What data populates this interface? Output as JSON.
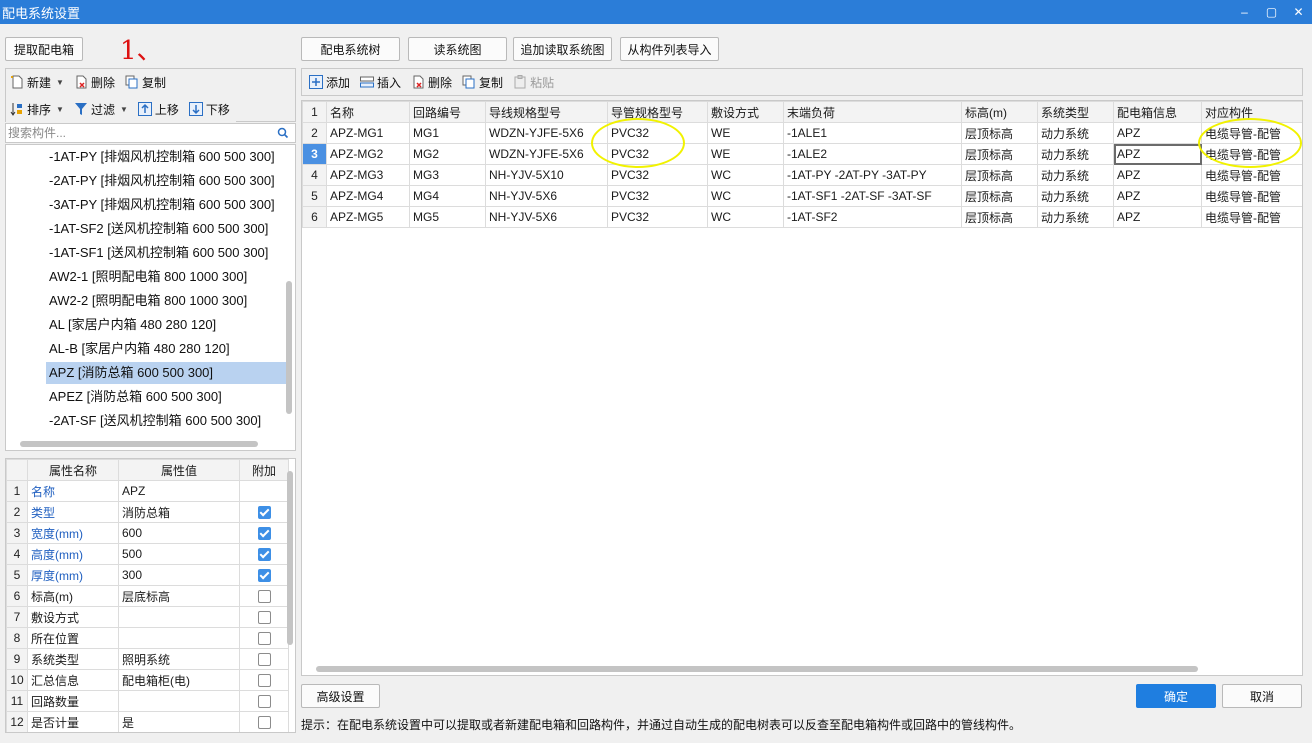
{
  "window": {
    "title": "配电系统设置",
    "minimize": "–",
    "maximize": "▢",
    "close": "✕"
  },
  "annotation": "1、",
  "left": {
    "extract_button": "提取配电箱",
    "toolbar1": {
      "new": "新建",
      "delete": "删除",
      "copy": "复制"
    },
    "toolbar2": {
      "sort": "排序",
      "filter": "过滤",
      "up": "上移",
      "down": "下移"
    },
    "search_placeholder": "搜索构件...",
    "tree_items": [
      "-1AT-PY [排烟风机控制箱 600 500 300]",
      "-2AT-PY [排烟风机控制箱 600 500 300]",
      "-3AT-PY [排烟风机控制箱 600 500 300]",
      "-1AT-SF2 [送风机控制箱 600 500 300]",
      "-1AT-SF1 [送风机控制箱 600 500 300]",
      "AW2-1 [照明配电箱 800 1000 300]",
      "AW2-2 [照明配电箱 800 1000 300]",
      "AL [家居户内箱 480 280 120]",
      "AL-B [家居户内箱 480 280 120]",
      "APZ [消防总箱 600 500 300]",
      "APEZ [消防总箱 600 500 300]",
      "-2AT-SF [送风机控制箱 600 500 300]"
    ],
    "properties": {
      "headers": [
        "属性名称",
        "属性值",
        "附加"
      ],
      "rows": [
        {
          "n": "1",
          "name": "名称",
          "value": "APZ",
          "blue": true,
          "check": null
        },
        {
          "n": "2",
          "name": "类型",
          "value": "消防总箱",
          "blue": true,
          "check": true
        },
        {
          "n": "3",
          "name": "宽度(mm)",
          "value": "600",
          "blue": true,
          "check": true
        },
        {
          "n": "4",
          "name": "高度(mm)",
          "value": "500",
          "blue": true,
          "check": true
        },
        {
          "n": "5",
          "name": "厚度(mm)",
          "value": "300",
          "blue": true,
          "check": true
        },
        {
          "n": "6",
          "name": "标高(m)",
          "value": "层底标高",
          "blue": false,
          "check": false
        },
        {
          "n": "7",
          "name": "敷设方式",
          "value": "",
          "blue": false,
          "check": false
        },
        {
          "n": "8",
          "name": "所在位置",
          "value": "",
          "blue": false,
          "check": false
        },
        {
          "n": "9",
          "name": "系统类型",
          "value": "照明系统",
          "blue": false,
          "check": false
        },
        {
          "n": "10",
          "name": "汇总信息",
          "value": "配电箱柜(电)",
          "blue": false,
          "check": false
        },
        {
          "n": "11",
          "name": "回路数量",
          "value": "",
          "blue": false,
          "check": false
        },
        {
          "n": "12",
          "name": "是否计量",
          "value": "是",
          "blue": false,
          "check": false
        }
      ]
    }
  },
  "top_buttons": {
    "tree": "配电系统树",
    "read": "读系统图",
    "append": "追加读取系统图",
    "import": "从构件列表导入"
  },
  "grid_toolbar": {
    "add": "添加",
    "insert": "插入",
    "delete": "删除",
    "copy": "复制",
    "paste": "粘贴"
  },
  "grid": {
    "headers": [
      "名称",
      "回路编号",
      "导线规格型号",
      "导管规格型号",
      "敷设方式",
      "末端负荷",
      "标高(m)",
      "系统类型",
      "配电箱信息",
      "对应构件"
    ],
    "rows": [
      {
        "n": "2",
        "cells": [
          "APZ-MG1",
          "MG1",
          "WDZN-YJFE-5X6",
          "PVC32",
          "WE",
          "-1ALE1",
          "层顶标高",
          "动力系统",
          "APZ",
          "电缆导管-配管"
        ]
      },
      {
        "n": "3",
        "cells": [
          "APZ-MG2",
          "MG2",
          "WDZN-YJFE-5X6",
          "PVC32",
          "WE",
          "-1ALE2",
          "层顶标高",
          "动力系统",
          "APZ",
          "电缆导管-配管"
        ]
      },
      {
        "n": "4",
        "cells": [
          "APZ-MG3",
          "MG3",
          "NH-YJV-5X10",
          "PVC32",
          "WC",
          "-1AT-PY -2AT-PY -3AT-PY",
          "层顶标高",
          "动力系统",
          "APZ",
          "电缆导管-配管"
        ]
      },
      {
        "n": "5",
        "cells": [
          "APZ-MG4",
          "MG4",
          "NH-YJV-5X6",
          "PVC32",
          "WC",
          "-1AT-SF1 -2AT-SF -3AT-SF",
          "层顶标高",
          "动力系统",
          "APZ",
          "电缆导管-配管"
        ]
      },
      {
        "n": "6",
        "cells": [
          "APZ-MG5",
          "MG5",
          "NH-YJV-5X6",
          "PVC32",
          "WC",
          "-1AT-SF2",
          "层顶标高",
          "动力系统",
          "APZ",
          "电缆导管-配管"
        ]
      }
    ]
  },
  "bottom": {
    "advanced": "高级设置",
    "ok": "确定",
    "cancel": "取消",
    "hint": "提示：在配电系统设置中可以提取或者新建配电箱和回路构件，并通过自动生成的配电树表可以反查至配电箱构件或回路中的管线构件。"
  },
  "colors": {
    "titlebar": "#2b7dd8",
    "accent": "#1f7ee0",
    "selection": "#b9d2f0",
    "highlight_ring": "#f1f200",
    "annotation": "#dd1111"
  }
}
